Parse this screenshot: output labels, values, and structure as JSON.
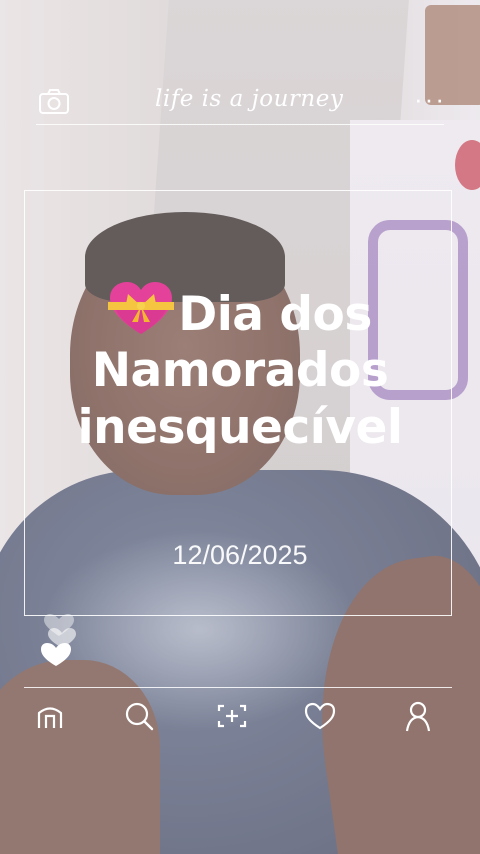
{
  "topbar": {
    "brand": "life is a journey",
    "menu_glyph": "···",
    "icons": {
      "left": "camera-icon",
      "right": "more-options-icon"
    }
  },
  "card": {
    "headline_lines": [
      "Dia dos",
      "Namorados",
      "inesquecível"
    ],
    "emoji": "heart-with-ribbon-emoji",
    "date": "12/06/2025"
  },
  "bottom_nav": {
    "items": [
      {
        "icon": "home-icon"
      },
      {
        "icon": "search-icon"
      },
      {
        "icon": "add-icon"
      },
      {
        "icon": "heart-icon"
      },
      {
        "icon": "profile-icon"
      }
    ]
  },
  "colors": {
    "overlay_text": "#ffffff",
    "emoji_heart": "#e4419a",
    "emoji_ribbon": "#f5c542"
  }
}
